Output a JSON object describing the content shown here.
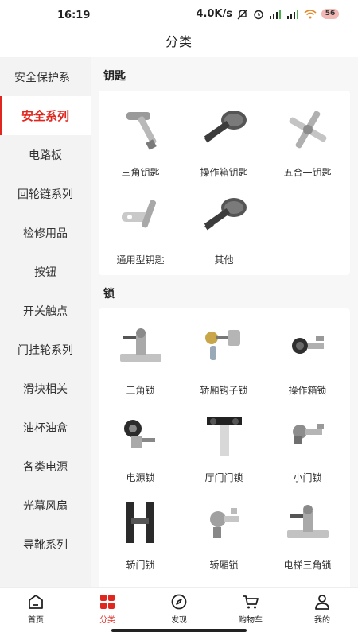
{
  "status_bar": {
    "time": "16:19",
    "network_speed": "4.0K/s",
    "battery_level": "56"
  },
  "header": {
    "title": "分类"
  },
  "sidebar": {
    "items": [
      {
        "label": "安全保护系"
      },
      {
        "label": "安全系列",
        "active": true
      },
      {
        "label": "电路板"
      },
      {
        "label": "回轮链系列"
      },
      {
        "label": "检修用品"
      },
      {
        "label": "按钮"
      },
      {
        "label": "开关触点"
      },
      {
        "label": "门挂轮系列"
      },
      {
        "label": "滑块相关"
      },
      {
        "label": "油杯油盒"
      },
      {
        "label": "各类电源"
      },
      {
        "label": "光幕风扇"
      },
      {
        "label": "导靴系列"
      }
    ]
  },
  "sections": [
    {
      "title": "钥匙",
      "products": [
        {
          "name": "三角钥匙",
          "icon": "triangle-key-image"
        },
        {
          "name": "操作箱钥匙",
          "icon": "panel-key-image"
        },
        {
          "name": "五合一钥匙",
          "icon": "cross-key-image"
        },
        {
          "name": "通用型钥匙",
          "icon": "universal-key-image"
        },
        {
          "name": "其他",
          "icon": "other-key-image"
        }
      ]
    },
    {
      "title": "锁",
      "products": [
        {
          "name": "三角锁",
          "icon": "triangle-lock-image"
        },
        {
          "name": "轿厢钩子锁",
          "icon": "hook-lock-image"
        },
        {
          "name": "操作箱锁",
          "icon": "panel-lock-image"
        },
        {
          "name": "电源锁",
          "icon": "power-lock-image"
        },
        {
          "name": "厅门门锁",
          "icon": "hall-door-lock-image"
        },
        {
          "name": "小门锁",
          "icon": "small-door-lock-image"
        },
        {
          "name": "轿门锁",
          "icon": "car-door-lock-image"
        },
        {
          "name": "轿厢锁",
          "icon": "car-lock-image"
        },
        {
          "name": "电梯三角锁",
          "icon": "elevator-triangle-lock-image"
        }
      ]
    }
  ],
  "bottom_nav": {
    "items": [
      {
        "label": "首页",
        "icon": "home-icon"
      },
      {
        "label": "分类",
        "icon": "category-icon",
        "active": true
      },
      {
        "label": "发现",
        "icon": "compass-icon"
      },
      {
        "label": "购物车",
        "icon": "cart-icon"
      },
      {
        "label": "我的",
        "icon": "user-icon"
      }
    ]
  },
  "colors": {
    "accent": "#e0271f",
    "background": "#f3f3f3",
    "card": "#ffffff"
  }
}
